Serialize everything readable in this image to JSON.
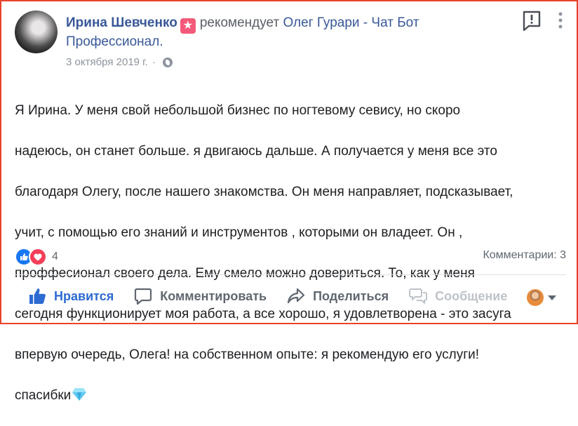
{
  "post": {
    "author": "Ирина Шевченко",
    "badge_glyph": "★",
    "recommends_text": "рекомендует",
    "page_name": "Олег Гурари - Чат Бот Профессионал.",
    "date": "3 октября 2019 г.",
    "date_separator": "·",
    "body_lines": [
      "Я Ирина. У меня свой небольшой бизнес по ногтевому севису, но скоро",
      "надеюсь, он станет больше. я двигаюсь дальше. А получается у меня все это",
      "благодаря Олегу, после нашего знакомства. Он меня направляет, подсказывает,",
      "учит, с помощью его знаний и инструментов , которыми он владеет. Он ,",
      "проффесионал своего дела. Ему смело можно довериться. То, как у меня",
      "сегодня функционирует моя работа, а все хорошо, я удовлетворена - это засуга",
      "впервую очередь, Олега! на собственном опыте: я рекомендую его услуги!",
      "спасибки"
    ],
    "emoji_name": "gem-icon"
  },
  "reactions": {
    "count": "4",
    "types": [
      "like",
      "love"
    ]
  },
  "comments": {
    "label": "Комментарии: 3"
  },
  "actions": {
    "like": "Нравится",
    "comment": "Комментировать",
    "share": "Поделиться",
    "message": "Сообщение"
  },
  "colors": {
    "border": "#e8432a",
    "link": "#385898",
    "like_active": "#2d6ad1",
    "muted": "#606770",
    "disabled": "#bec3c9"
  }
}
